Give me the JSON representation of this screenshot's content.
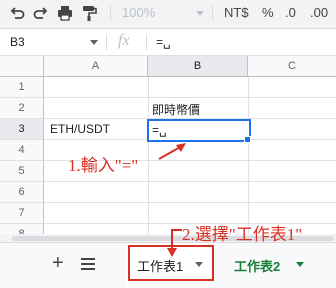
{
  "toolbar": {
    "zoom": "100%",
    "currency": "NT$",
    "percent": "%",
    "decrease_decimals": ".0",
    "increase_decimals": ".00"
  },
  "formula_bar": {
    "cell_ref": "B3",
    "fx": "fx",
    "content": "=␣"
  },
  "grid": {
    "columns": [
      "A",
      "B",
      "C"
    ],
    "rows": [
      "1",
      "2",
      "3",
      "4",
      "5",
      "6",
      "7",
      "8"
    ],
    "cells": {
      "B2": "即時幣價",
      "A3": "ETH/USDT",
      "B3": "=␣"
    }
  },
  "sheets": {
    "add": "+",
    "tabs": [
      {
        "label": "工作表1",
        "active": true
      },
      {
        "label": "工作表2",
        "active": false
      }
    ]
  },
  "annotations": {
    "step1": "1.輸入\"=\"",
    "step2": "2.選擇\"工作表1\""
  },
  "colors": {
    "annotation": "#d93025",
    "selection": "#1a73e8",
    "sheet2": "#188038"
  }
}
